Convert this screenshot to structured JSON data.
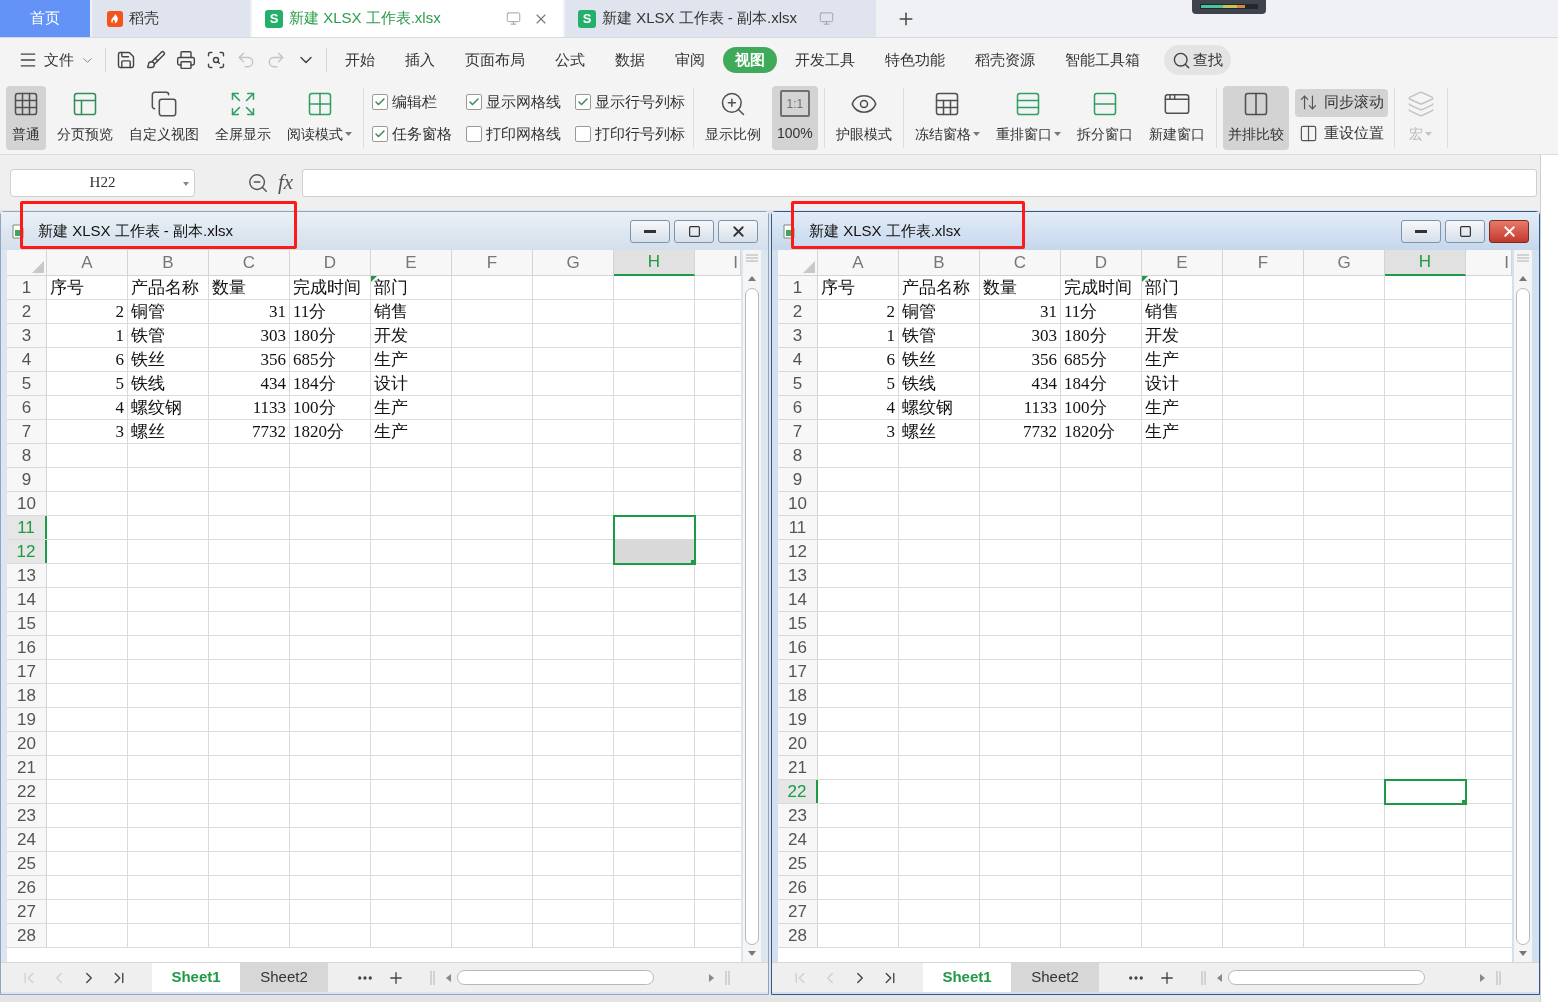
{
  "tabs": [
    {
      "label": "首页",
      "kind": "home",
      "selected": false
    },
    {
      "label": "稻壳",
      "kind": "docer",
      "selected": false
    },
    {
      "label": "新建 XLSX 工作表.xlsx",
      "kind": "sheet",
      "badge": "S",
      "selected": true
    },
    {
      "label": "新建 XLSX 工作表 - 副本.xlsx",
      "kind": "sheet",
      "badge": "S",
      "selected": false
    }
  ],
  "quick_access": [
    {
      "disabled": false
    },
    {
      "disabled": false
    },
    {
      "disabled": false
    },
    {
      "disabled": false
    },
    {
      "disabled": true
    },
    {
      "disabled": true
    },
    {
      "disabled": false
    }
  ],
  "menu": {
    "file": "文件",
    "tabs": [
      {
        "label": "开始",
        "selected": false
      },
      {
        "label": "插入",
        "selected": false
      },
      {
        "label": "页面布局",
        "selected": false
      },
      {
        "label": "公式",
        "selected": false
      },
      {
        "label": "数据",
        "selected": false
      },
      {
        "label": "审阅",
        "selected": false
      },
      {
        "label": "视图",
        "selected": true
      },
      {
        "label": "开发工具",
        "selected": false
      },
      {
        "label": "特色功能",
        "selected": false
      },
      {
        "label": "稻壳资源",
        "selected": false
      },
      {
        "label": "智能工具箱",
        "selected": false
      }
    ],
    "search": "查找"
  },
  "ribbon": [
    {
      "items": [
        {
          "kind": "big",
          "label": "普通",
          "selected": true,
          "dropdown": false,
          "disabled": false
        },
        {
          "kind": "big",
          "label": "分页预览",
          "selected": false,
          "dropdown": false,
          "disabled": false
        },
        {
          "kind": "big",
          "label": "自定义视图",
          "selected": false,
          "dropdown": false,
          "disabled": false
        },
        {
          "kind": "big",
          "label": "全屏显示",
          "selected": false,
          "dropdown": false,
          "disabled": false
        },
        {
          "kind": "big",
          "label": "阅读模式",
          "selected": false,
          "dropdown": true,
          "disabled": false
        }
      ]
    },
    {
      "items": [
        {
          "kind": "check",
          "label": "编辑栏",
          "checked": true
        },
        {
          "kind": "check",
          "label": "任务窗格",
          "checked": true
        },
        {
          "kind": "check",
          "label": "显示网格线",
          "checked": true
        },
        {
          "kind": "check",
          "label": "打印网格线",
          "checked": false
        },
        {
          "kind": "check",
          "label": "显示行号列标",
          "checked": true
        },
        {
          "kind": "check",
          "label": "打印行号列标",
          "checked": false
        }
      ]
    },
    {
      "items": [
        {
          "kind": "big",
          "label": "显示比例",
          "selected": false,
          "dropdown": false,
          "disabled": false
        },
        {
          "kind": "big",
          "label": "100%",
          "badge": "1:1",
          "selected": true,
          "dropdown": false,
          "disabled": false
        }
      ]
    },
    {
      "items": [
        {
          "kind": "big",
          "label": "护眼模式",
          "selected": false,
          "dropdown": false,
          "disabled": false
        }
      ]
    },
    {
      "items": [
        {
          "kind": "big",
          "label": "冻结窗格",
          "selected": false,
          "dropdown": true,
          "disabled": false
        },
        {
          "kind": "big",
          "label": "重排窗口",
          "selected": false,
          "dropdown": true,
          "disabled": false
        },
        {
          "kind": "big",
          "label": "拆分窗口",
          "selected": false,
          "dropdown": false,
          "disabled": false
        },
        {
          "kind": "big",
          "label": "新建窗口",
          "selected": false,
          "dropdown": false,
          "disabled": false
        }
      ]
    },
    {
      "items": [
        {
          "kind": "big",
          "label": "并排比较",
          "selected": true,
          "dropdown": false,
          "disabled": false
        },
        {
          "kind": "small",
          "label": "同步滚动",
          "selected": true
        },
        {
          "kind": "small",
          "label": "重设位置",
          "selected": false
        }
      ]
    },
    {
      "items": [
        {
          "kind": "big",
          "label": "宏",
          "selected": false,
          "dropdown": true,
          "disabled": true
        }
      ]
    }
  ],
  "formula_bar": {
    "name_box": "H22",
    "function_button": "fx"
  },
  "windows": [
    {
      "title": "新建 XLSX 工作表 - 副本.xlsx",
      "active": false,
      "title_highlighted": true,
      "columns": [
        {
          "label": "A",
          "selected": false
        },
        {
          "label": "B",
          "selected": false
        },
        {
          "label": "C",
          "selected": false
        },
        {
          "label": "D",
          "selected": false
        },
        {
          "label": "E",
          "selected": false
        },
        {
          "label": "F",
          "selected": false
        },
        {
          "label": "G",
          "selected": false
        },
        {
          "label": "H",
          "selected": true
        },
        {
          "label": "I",
          "selected": false
        }
      ],
      "rows": [
        {
          "number": "1",
          "selected": false,
          "cells": [
            {
              "text": "序号",
              "kind": "text",
              "flagged": false
            },
            {
              "text": "产品名称",
              "kind": "text",
              "flagged": false
            },
            {
              "text": "数量",
              "kind": "text",
              "flagged": false
            },
            {
              "text": "完成时间",
              "kind": "text",
              "flagged": false
            },
            {
              "text": "部门",
              "kind": "text",
              "flagged": true
            }
          ]
        },
        {
          "number": "2",
          "selected": false,
          "cells": [
            {
              "text": "2",
              "kind": "number",
              "flagged": false
            },
            {
              "text": "铜管",
              "kind": "text",
              "flagged": false
            },
            {
              "text": "31",
              "kind": "number",
              "flagged": false
            },
            {
              "text": "11分",
              "kind": "text",
              "flagged": false
            },
            {
              "text": "销售",
              "kind": "text",
              "flagged": false
            }
          ]
        },
        {
          "number": "3",
          "selected": false,
          "cells": [
            {
              "text": "1",
              "kind": "number",
              "flagged": false
            },
            {
              "text": "铁管",
              "kind": "text",
              "flagged": false
            },
            {
              "text": "303",
              "kind": "number",
              "flagged": false
            },
            {
              "text": "180分",
              "kind": "text",
              "flagged": false
            },
            {
              "text": "开发",
              "kind": "text",
              "flagged": false
            }
          ]
        },
        {
          "number": "4",
          "selected": false,
          "cells": [
            {
              "text": "6",
              "kind": "number",
              "flagged": false
            },
            {
              "text": "铁丝",
              "kind": "text",
              "flagged": false
            },
            {
              "text": "356",
              "kind": "number",
              "flagged": false
            },
            {
              "text": "685分",
              "kind": "text",
              "flagged": false
            },
            {
              "text": "生产",
              "kind": "text",
              "flagged": false
            }
          ]
        },
        {
          "number": "5",
          "selected": false,
          "cells": [
            {
              "text": "5",
              "kind": "number",
              "flagged": false
            },
            {
              "text": "铁线",
              "kind": "text",
              "flagged": false
            },
            {
              "text": "434",
              "kind": "number",
              "flagged": false
            },
            {
              "text": "184分",
              "kind": "text",
              "flagged": false
            },
            {
              "text": "设计",
              "kind": "text",
              "flagged": false
            }
          ]
        },
        {
          "number": "6",
          "selected": false,
          "cells": [
            {
              "text": "4",
              "kind": "number",
              "flagged": false
            },
            {
              "text": "螺纹钢",
              "kind": "text",
              "flagged": false
            },
            {
              "text": "1133",
              "kind": "number",
              "flagged": false
            },
            {
              "text": "100分",
              "kind": "text",
              "flagged": false
            },
            {
              "text": "生产",
              "kind": "text",
              "flagged": false
            }
          ]
        },
        {
          "number": "7",
          "selected": false,
          "cells": [
            {
              "text": "3",
              "kind": "number",
              "flagged": false
            },
            {
              "text": "螺丝",
              "kind": "text",
              "flagged": false
            },
            {
              "text": "7732",
              "kind": "number",
              "flagged": false
            },
            {
              "text": "1820分",
              "kind": "text",
              "flagged": false
            },
            {
              "text": "生产",
              "kind": "text",
              "flagged": false
            }
          ]
        },
        {
          "number": "8",
          "selected": false
        },
        {
          "number": "9",
          "selected": false
        },
        {
          "number": "10",
          "selected": false
        },
        {
          "number": "11",
          "selected": true
        },
        {
          "number": "12",
          "selected": true
        },
        {
          "number": "13",
          "selected": false
        },
        {
          "number": "14",
          "selected": false
        },
        {
          "number": "15",
          "selected": false
        },
        {
          "number": "16",
          "selected": false
        },
        {
          "number": "17",
          "selected": false
        },
        {
          "number": "18",
          "selected": false
        },
        {
          "number": "19",
          "selected": false
        },
        {
          "number": "20",
          "selected": false
        },
        {
          "number": "21",
          "selected": false
        },
        {
          "number": "22",
          "selected": false
        },
        {
          "number": "23",
          "selected": false
        },
        {
          "number": "24",
          "selected": false
        },
        {
          "number": "25",
          "selected": false
        },
        {
          "number": "26",
          "selected": false
        },
        {
          "number": "27",
          "selected": false
        },
        {
          "number": "28",
          "selected": false
        }
      ],
      "nav_buttons": [
        {
          "disabled": true
        },
        {
          "disabled": true
        },
        {
          "disabled": false
        },
        {
          "disabled": false
        }
      ],
      "sheets": [
        {
          "label": "Sheet1",
          "selected": true
        },
        {
          "label": "Sheet2",
          "selected": false
        }
      ]
    },
    {
      "title": "新建 XLSX 工作表.xlsx",
      "active": true,
      "title_highlighted": true,
      "columns": [
        {
          "label": "A",
          "selected": false
        },
        {
          "label": "B",
          "selected": false
        },
        {
          "label": "C",
          "selected": false
        },
        {
          "label": "D",
          "selected": false
        },
        {
          "label": "E",
          "selected": false
        },
        {
          "label": "F",
          "selected": false
        },
        {
          "label": "G",
          "selected": false
        },
        {
          "label": "H",
          "selected": true
        },
        {
          "label": "I",
          "selected": false
        }
      ],
      "rows": [
        {
          "number": "1",
          "selected": false,
          "cells": [
            {
              "text": "序号",
              "kind": "text",
              "flagged": false
            },
            {
              "text": "产品名称",
              "kind": "text",
              "flagged": false
            },
            {
              "text": "数量",
              "kind": "text",
              "flagged": false
            },
            {
              "text": "完成时间",
              "kind": "text",
              "flagged": false
            },
            {
              "text": "部门",
              "kind": "text",
              "flagged": true
            }
          ]
        },
        {
          "number": "2",
          "selected": false,
          "cells": [
            {
              "text": "2",
              "kind": "number",
              "flagged": false
            },
            {
              "text": "铜管",
              "kind": "text",
              "flagged": false
            },
            {
              "text": "31",
              "kind": "number",
              "flagged": false
            },
            {
              "text": "11分",
              "kind": "text",
              "flagged": false
            },
            {
              "text": "销售",
              "kind": "text",
              "flagged": false
            }
          ]
        },
        {
          "number": "3",
          "selected": false,
          "cells": [
            {
              "text": "1",
              "kind": "number",
              "flagged": false
            },
            {
              "text": "铁管",
              "kind": "text",
              "flagged": false
            },
            {
              "text": "303",
              "kind": "number",
              "flagged": false
            },
            {
              "text": "180分",
              "kind": "text",
              "flagged": false
            },
            {
              "text": "开发",
              "kind": "text",
              "flagged": false
            }
          ]
        },
        {
          "number": "4",
          "selected": false,
          "cells": [
            {
              "text": "6",
              "kind": "number",
              "flagged": false
            },
            {
              "text": "铁丝",
              "kind": "text",
              "flagged": false
            },
            {
              "text": "356",
              "kind": "number",
              "flagged": false
            },
            {
              "text": "685分",
              "kind": "text",
              "flagged": false
            },
            {
              "text": "生产",
              "kind": "text",
              "flagged": false
            }
          ]
        },
        {
          "number": "5",
          "selected": false,
          "cells": [
            {
              "text": "5",
              "kind": "number",
              "flagged": false
            },
            {
              "text": "铁线",
              "kind": "text",
              "flagged": false
            },
            {
              "text": "434",
              "kind": "number",
              "flagged": false
            },
            {
              "text": "184分",
              "kind": "text",
              "flagged": false
            },
            {
              "text": "设计",
              "kind": "text",
              "flagged": false
            }
          ]
        },
        {
          "number": "6",
          "selected": false,
          "cells": [
            {
              "text": "4",
              "kind": "number",
              "flagged": false
            },
            {
              "text": "螺纹钢",
              "kind": "text",
              "flagged": false
            },
            {
              "text": "1133",
              "kind": "number",
              "flagged": false
            },
            {
              "text": "100分",
              "kind": "text",
              "flagged": false
            },
            {
              "text": "生产",
              "kind": "text",
              "flagged": false
            }
          ]
        },
        {
          "number": "7",
          "selected": false,
          "cells": [
            {
              "text": "3",
              "kind": "number",
              "flagged": false
            },
            {
              "text": "螺丝",
              "kind": "text",
              "flagged": false
            },
            {
              "text": "7732",
              "kind": "number",
              "flagged": false
            },
            {
              "text": "1820分",
              "kind": "text",
              "flagged": false
            },
            {
              "text": "生产",
              "kind": "text",
              "flagged": false
            }
          ]
        },
        {
          "number": "8",
          "selected": false
        },
        {
          "number": "9",
          "selected": false
        },
        {
          "number": "10",
          "selected": false
        },
        {
          "number": "11",
          "selected": false
        },
        {
          "number": "12",
          "selected": false
        },
        {
          "number": "13",
          "selected": false
        },
        {
          "number": "14",
          "selected": false
        },
        {
          "number": "15",
          "selected": false
        },
        {
          "number": "16",
          "selected": false
        },
        {
          "number": "17",
          "selected": false
        },
        {
          "number": "18",
          "selected": false
        },
        {
          "number": "19",
          "selected": false
        },
        {
          "number": "20",
          "selected": false
        },
        {
          "number": "21",
          "selected": false
        },
        {
          "number": "22",
          "selected": true
        },
        {
          "number": "23",
          "selected": false
        },
        {
          "number": "24",
          "selected": false
        },
        {
          "number": "25",
          "selected": false
        },
        {
          "number": "26",
          "selected": false
        },
        {
          "number": "27",
          "selected": false
        },
        {
          "number": "28",
          "selected": false
        }
      ],
      "nav_buttons": [
        {
          "disabled": true
        },
        {
          "disabled": true
        },
        {
          "disabled": false
        },
        {
          "disabled": false
        }
      ],
      "sheets": [
        {
          "label": "Sheet1",
          "selected": true
        },
        {
          "label": "Sheet2",
          "selected": false
        }
      ]
    }
  ]
}
